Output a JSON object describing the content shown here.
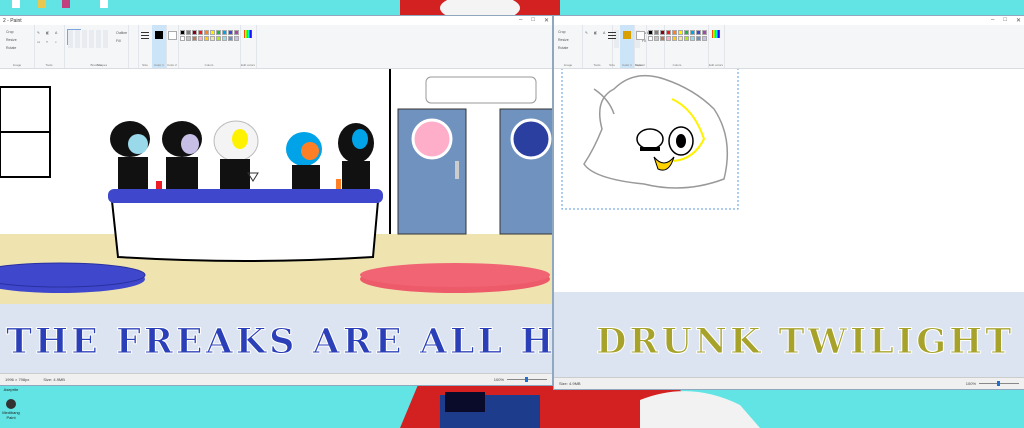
{
  "desktop": {
    "icons": [
      {
        "label": "Aseprite",
        "color": "#c0d0e0"
      },
      {
        "label": "Medibang Paint",
        "color": "#333333"
      }
    ]
  },
  "left_window": {
    "title": "2 - Paint",
    "ribbon": {
      "clipboard_items": [
        "Crop",
        "Resize",
        "Rotate"
      ],
      "groups": [
        "Image",
        "Tools",
        "Brushes",
        "Shapes",
        "Size",
        "Color 1",
        "Color 2",
        "Colors",
        "Edit colors"
      ],
      "shape_options": [
        "Outline",
        "Fill"
      ]
    },
    "status": {
      "dimensions": "1996 × 798px",
      "size": "Size: 4.9MB",
      "zoom": "100%"
    },
    "caption": "THE FREAKS ARE ALL HERE!!!",
    "caption_color": "#2a3fb8"
  },
  "right_window": {
    "title": "",
    "ribbon": {
      "clipboard_items": [
        "Crop",
        "Resize",
        "Rotate"
      ],
      "shape_options": [
        "Outline",
        "Fill"
      ],
      "groups": [
        "Image",
        "Tools",
        "Shapes",
        "Size",
        "Color 1",
        "Color 2",
        "Colors",
        "Edit colors"
      ]
    },
    "status": {
      "size": "Size: 4.9MB",
      "zoom": "100%"
    },
    "caption": "DRUNK TWILIGHT",
    "caption_color": "#a6a22a"
  },
  "palette_colors": [
    "#000000",
    "#7f7f7f",
    "#880015",
    "#ed1c24",
    "#ff7f27",
    "#fff200",
    "#22b14c",
    "#00a2e8",
    "#3f48cc",
    "#a349a4",
    "#ffffff",
    "#c3c3c3",
    "#b97a57",
    "#ffaec9",
    "#ffc90e",
    "#efe4b0",
    "#b5e61d",
    "#99d9ea",
    "#7092be",
    "#c8bfe7"
  ],
  "taskbar_hint": ""
}
